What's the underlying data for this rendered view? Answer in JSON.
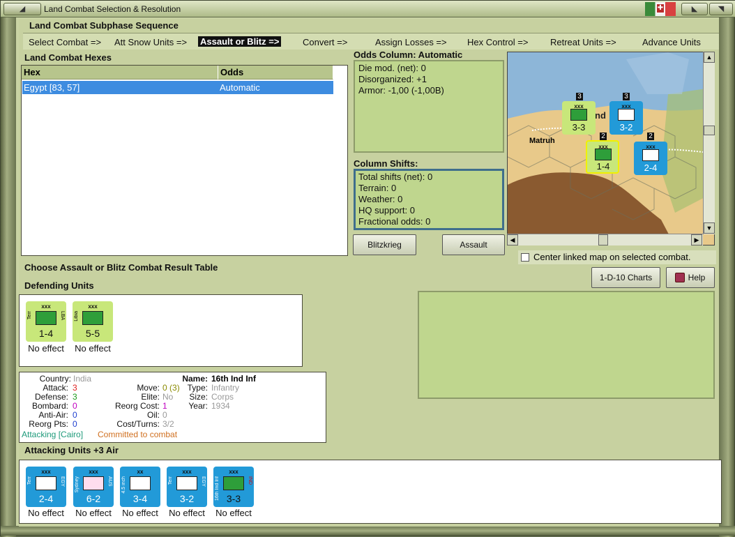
{
  "window": {
    "title": "Land Combat Selection & Resolution"
  },
  "subphase": {
    "title": "Land Combat Subphase Sequence",
    "steps": [
      "Select Combat =>",
      "Att Snow Units =>",
      "Assault or Blitz =>",
      "Convert =>",
      "Assign Losses =>",
      "Hex Control =>",
      "Retreat Units =>",
      "Advance Units"
    ],
    "current_index": 2
  },
  "hexes": {
    "title": "Land Combat Hexes",
    "columns": [
      "Hex",
      "Odds"
    ],
    "rows": [
      {
        "hex": "Egypt [83, 57]",
        "odds": "Automatic"
      }
    ]
  },
  "odds": {
    "title": "Odds Column: Automatic",
    "lines": [
      "Die mod. (net): 0",
      "Disorganized: +1",
      "Armor: -1,00 (-1,00B)"
    ]
  },
  "shifts": {
    "title": "Column Shifts:",
    "lines": [
      "Total shifts (net): 0",
      "Terrain: 0",
      "Weather: 0",
      "HQ support: 0",
      "Fractional odds: 0"
    ]
  },
  "buttons": {
    "blitzkrieg": "Blitzkrieg",
    "assault": "Assault",
    "charts": "1-D-10 Charts",
    "help": "Help"
  },
  "map": {
    "place_label": "Matruh",
    "counters": [
      {
        "xxx": "xxx",
        "value": "3-3",
        "stack": "3"
      },
      {
        "xxx": "xxx",
        "value": "3-2",
        "stack": "3"
      },
      {
        "xxx": "xxx",
        "value": "1-4",
        "stack": "2"
      },
      {
        "xxx": "xxx",
        "value": "2-4",
        "stack": "2"
      }
    ]
  },
  "center_map": {
    "label": "Center linked map on selected combat."
  },
  "choose_label": "Choose Assault or Blitz Combat Result Table",
  "defending": {
    "title": "Defending Units",
    "units": [
      {
        "xxx": "xxx",
        "value": "1-4",
        "left": "Terr",
        "right": "LBA",
        "effect": "No effect"
      },
      {
        "xxx": "xxx",
        "value": "5-5",
        "left": "Libia",
        "right": "",
        "effect": "No effect"
      }
    ]
  },
  "info": {
    "name_label": "Name:",
    "name": "16th Ind Inf",
    "country_label": "Country:",
    "country": "India",
    "attack_label": "Attack:",
    "attack": "3",
    "defense_label": "Defense:",
    "defense": "3",
    "bombard_label": "Bombard:",
    "bombard": "0",
    "antiair_label": "Anti-Air:",
    "antiair": "0",
    "reorg_label": "Reorg Pts:",
    "reorg": "0",
    "move_label": "Move:",
    "move": "0",
    "move_extra": "(3)",
    "elite_label": "Elite:",
    "elite": "No",
    "reorgcost_label": "Reorg Cost:",
    "reorgcost": "1",
    "oil_label": "Oil:",
    "oil": "0",
    "costturns_label": "Cost/Turns:",
    "costturns": "3/2",
    "type_label": "Type:",
    "type": "Infantry",
    "size_label": "Size:",
    "size": "Corps",
    "year_label": "Year:",
    "year": "1934",
    "status_attacking": "Attacking [Cairo]",
    "status_committed": "Committed to combat"
  },
  "attacking": {
    "title": "Attacking Units +3 Air",
    "units": [
      {
        "xxx": "xxx",
        "value": "2-4",
        "left": "Terr",
        "right": "EGY",
        "effect": "No effect"
      },
      {
        "xxx": "xxx",
        "value": "6-2",
        "left": "Sydney",
        "right": "AUS",
        "effect": "No effect"
      },
      {
        "xxx": "xx",
        "value": "3-4",
        "left": "4.5 inch",
        "right": "",
        "effect": "No effect"
      },
      {
        "xxx": "xxx",
        "value": "3-2",
        "left": "Terr",
        "right": "EGY",
        "effect": "No effect"
      },
      {
        "xxx": "xxx",
        "value": "3-3",
        "left": "16th Ind Inf",
        "right": "IND",
        "effect": "No effect"
      }
    ]
  },
  "colors": {
    "accent": "#229ad8",
    "panel_green": "#bfd68e",
    "attack_red": "#e02020",
    "defense_green": "#1a9a1a",
    "bombard_magenta": "#c000c0",
    "antiair_blue": "#2040d0",
    "status_teal": "#1e9a7a",
    "status_orange": "#d07020"
  }
}
